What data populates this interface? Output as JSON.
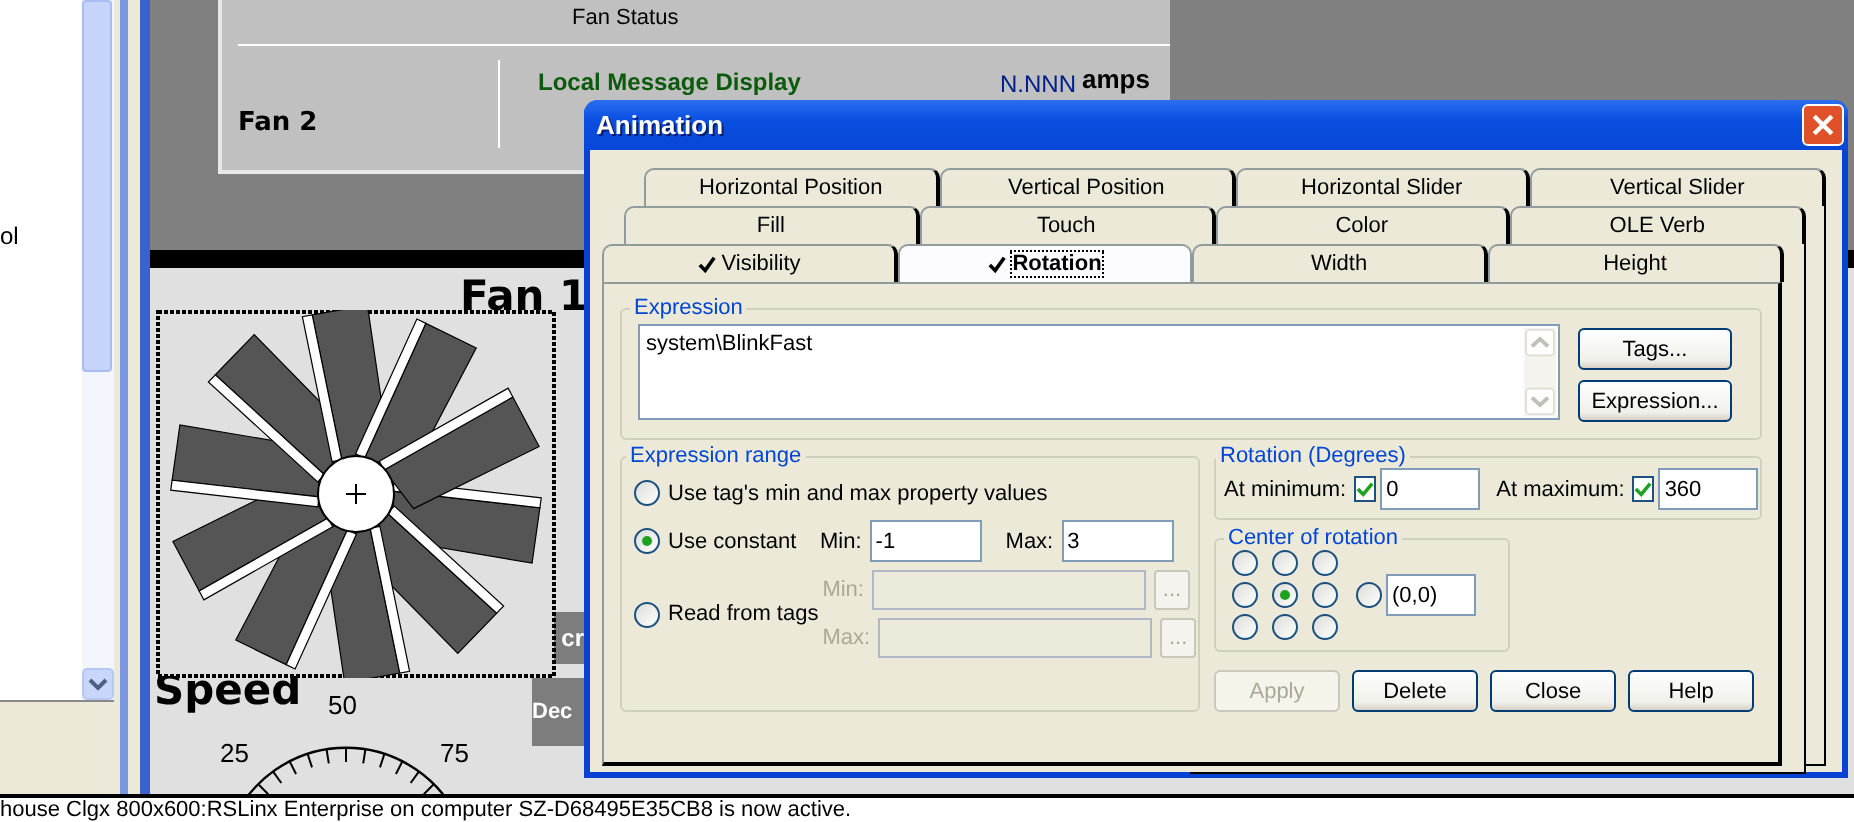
{
  "side_panel": {
    "text": "ol"
  },
  "display": {
    "status_panel": {
      "title": "Fan Status",
      "row_label": "Fan 2",
      "message_label": "Local Message Display",
      "value": "N.NNN",
      "unit": "amps"
    },
    "fan_title": "Fan 1",
    "speed_label": "Speed",
    "gauge_labels": [
      "25",
      "50",
      "75"
    ],
    "buttons": [
      "cr",
      "Dec"
    ]
  },
  "dialog": {
    "title": "Animation",
    "tab_rows": [
      [
        {
          "label": "Horizontal Position",
          "selected": false,
          "checked": false
        },
        {
          "label": "Vertical Position",
          "selected": false,
          "checked": false
        },
        {
          "label": "Horizontal Slider",
          "selected": false,
          "checked": false
        },
        {
          "label": "Vertical Slider",
          "selected": false,
          "checked": false
        }
      ],
      [
        {
          "label": "Fill",
          "selected": false,
          "checked": false
        },
        {
          "label": "Touch",
          "selected": false,
          "checked": false
        },
        {
          "label": "Color",
          "selected": false,
          "checked": false
        },
        {
          "label": "OLE Verb",
          "selected": false,
          "checked": false
        }
      ],
      [
        {
          "label": "Visibility",
          "selected": false,
          "checked": true
        },
        {
          "label": "Rotation",
          "selected": true,
          "checked": true
        },
        {
          "label": "Width",
          "selected": false,
          "checked": false
        },
        {
          "label": "Height",
          "selected": false,
          "checked": false
        }
      ]
    ],
    "expression": {
      "label": "Expression",
      "value": "system\\BlinkFast",
      "buttons": [
        "Tags...",
        "Expression..."
      ]
    },
    "expression_range": {
      "label": "Expression range",
      "options": [
        {
          "kind": "plain",
          "label": "Use tag's min and max property values",
          "selected": false
        },
        {
          "kind": "constant",
          "label": "Use constant",
          "selected": true,
          "min_label": "Min:",
          "min": "-1",
          "max_label": "Max:",
          "max": "3"
        },
        {
          "kind": "tags",
          "label": "Read from tags",
          "selected": false,
          "min_label": "Min:",
          "max_label": "Max:",
          "browse_label": "...",
          "disabled": true
        }
      ]
    },
    "rotation": {
      "label": "Rotation (Degrees)",
      "min_label": "At minimum:",
      "min_checked": true,
      "min": "0",
      "max_label": "At maximum:",
      "max_checked": true,
      "max": "360"
    },
    "center": {
      "label": "Center of rotation",
      "points": [
        {
          "selected": false
        },
        {
          "selected": false
        },
        {
          "selected": false
        },
        {
          "selected": false
        },
        {
          "selected": true
        },
        {
          "selected": false
        },
        {
          "selected": false
        },
        {
          "selected": false
        },
        {
          "selected": false
        }
      ],
      "custom": {
        "selected": false,
        "value": "(0,0)"
      }
    },
    "buttons": [
      {
        "label": "Apply",
        "disabled": true
      },
      {
        "label": "Delete",
        "disabled": false
      },
      {
        "label": "Close",
        "disabled": false
      },
      {
        "label": "Help",
        "disabled": false
      }
    ]
  },
  "status_bar": "house Clgx 800x600:RSLinx Enterprise on computer SZ-D68495E35CB8 is now active."
}
